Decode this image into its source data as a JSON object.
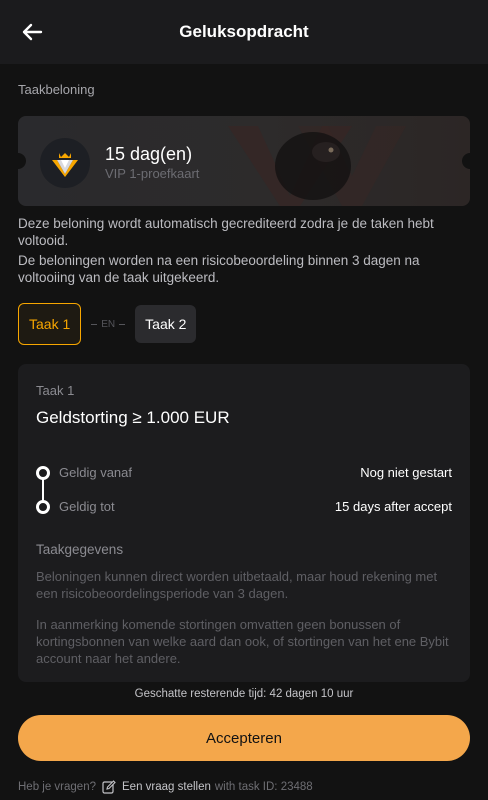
{
  "header": {
    "title": "Geluksopdracht",
    "back_icon": "arrow-left-icon"
  },
  "reward": {
    "section_label": "Taakbeloning",
    "title": "15 dag(en)",
    "subtitle": "VIP 1-proefkaart",
    "badge_icon": "vip-diamond-crown-icon",
    "accent": "#f7a600"
  },
  "info": {
    "line1": "Deze beloning wordt automatisch gecrediteerd zodra je de taken hebt voltooid.",
    "line2": "De beloningen worden na een risicobeoordeling binnen 3 dagen na voltooiing van de taak uitgekeerd."
  },
  "tabs": {
    "items": [
      {
        "label": "Taak 1",
        "active": true
      },
      {
        "label": "Taak 2",
        "active": false
      }
    ],
    "separator": "EN"
  },
  "task": {
    "number_label": "Taak 1",
    "requirement": "Geldstorting ≥ 1.000 EUR",
    "valid_from_label": "Geldig vanaf",
    "valid_from_value": "Nog niet gestart",
    "valid_to_label": "Geldig tot",
    "valid_to_value": "15 days after accept",
    "details_title": "Taakgegevens",
    "details_p1": "Beloningen kunnen direct worden uitbetaald, maar houd rekening met een risicobeoordelingsperiode van 3 dagen.",
    "details_p2": "In aanmerking komende stortingen omvatten geen bonussen of kortingsbonnen van welke aard dan ook, of stortingen van het ene Bybit account naar het andere."
  },
  "remaining_time": "Geschatte resterende tijd: 42 dagen 10 uur",
  "accept_label": "Accepteren",
  "footer": {
    "question": "Heb je vragen?",
    "edit_icon": "edit-icon",
    "link": "Een vraag stellen",
    "tail": "with task ID: 23488"
  },
  "colors": {
    "background": "#121212",
    "card": "#1c1c1e",
    "button": "#f4a74b",
    "accent": "#f7a600"
  }
}
